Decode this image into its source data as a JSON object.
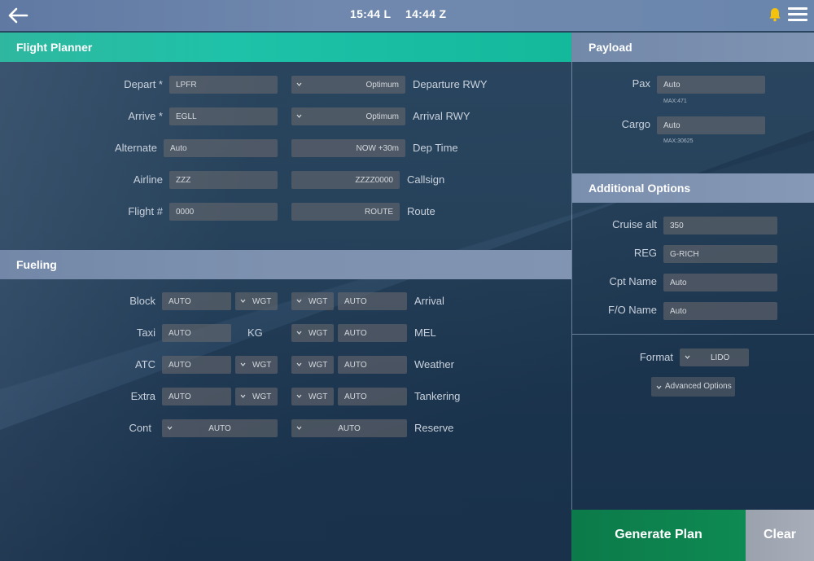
{
  "topbar": {
    "local_time": "15:44 L",
    "zulu_time": "14:44 Z",
    "back_icon": "arrow-left-icon",
    "notification_icon": "bell-icon",
    "menu_icon": "hamburger-menu-icon"
  },
  "flight_planner": {
    "title": "Flight Planner",
    "depart": {
      "label": "Depart *",
      "value": "LPFR"
    },
    "arrive": {
      "label": "Arrive *",
      "value": "EGLL"
    },
    "alternate": {
      "label": "Alternate",
      "value": "Auto"
    },
    "airline": {
      "label": "Airline",
      "value": "ZZZ"
    },
    "flight_no": {
      "label": "Flight #",
      "value": "0000"
    },
    "departure_rwy": {
      "label": "Departure RWY",
      "value": "Optimum"
    },
    "arrival_rwy": {
      "label": "Arrival RWY",
      "value": "Optimum"
    },
    "dep_time": {
      "label": "Dep Time",
      "value": "NOW +30m"
    },
    "callsign": {
      "label": "Callsign",
      "value": "ZZZZ0000"
    },
    "route": {
      "label": "Route",
      "value": "ROUTE"
    }
  },
  "fueling": {
    "title": "Fueling",
    "unit_label": "KG",
    "left": [
      {
        "label": "Block",
        "value": "AUTO",
        "unit": "WGT"
      },
      {
        "label": "Taxi",
        "value": "AUTO",
        "unit": ""
      },
      {
        "label": "ATC",
        "value": "AUTO",
        "unit": "WGT"
      },
      {
        "label": "Extra",
        "value": "AUTO",
        "unit": "WGT"
      }
    ],
    "cont": {
      "label": "Cont",
      "value": "AUTO"
    },
    "right": [
      {
        "label": "Arrival",
        "value": "AUTO",
        "unit": "WGT"
      },
      {
        "label": "MEL",
        "value": "AUTO",
        "unit": "WGT"
      },
      {
        "label": "Weather",
        "value": "AUTO",
        "unit": "WGT"
      },
      {
        "label": "Tankering",
        "value": "AUTO",
        "unit": "WGT"
      }
    ],
    "reserve": {
      "label": "Reserve",
      "value": "AUTO"
    }
  },
  "payload": {
    "title": "Payload",
    "pax": {
      "label": "Pax",
      "value": "Auto",
      "max": "MAX:471"
    },
    "cargo": {
      "label": "Cargo",
      "value": "Auto",
      "max": "MAX:30625"
    }
  },
  "additional": {
    "title": "Additional Options",
    "cruise_alt": {
      "label": "Cruise alt",
      "value": "350"
    },
    "reg": {
      "label": "REG",
      "value": "G-RICH"
    },
    "cpt_name": {
      "label": "Cpt Name",
      "value": "Auto"
    },
    "fo_name": {
      "label": "F/O Name",
      "value": "Auto"
    },
    "format": {
      "label": "Format",
      "value": "LIDO"
    },
    "advanced": "Advanced Options"
  },
  "actions": {
    "generate": "Generate Plan",
    "clear": "Clear"
  },
  "colors": {
    "accent_teal": "#1ec2a8",
    "generate_green": "#0e8a52",
    "clear_grey": "#a8aeb9",
    "bell_yellow": "#f4c20d"
  }
}
